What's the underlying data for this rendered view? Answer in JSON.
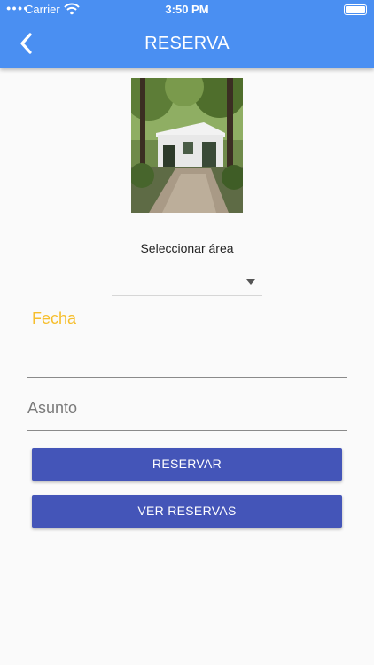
{
  "status_bar": {
    "carrier": "Carrier",
    "time": "3:50 PM"
  },
  "header": {
    "title": "RESERVA",
    "back_icon": "chevron-left-icon"
  },
  "area": {
    "label": "Seleccionar área",
    "selected": ""
  },
  "fecha": {
    "label": "Fecha",
    "value": ""
  },
  "asunto": {
    "placeholder": "Asunto",
    "value": ""
  },
  "buttons": {
    "reserve_label": "RESERVAR",
    "view_label": "VER RESERVAS"
  },
  "colors": {
    "appbar": "#4a8ff2",
    "button": "#4455b8",
    "fecha_label": "#f6be2c"
  }
}
